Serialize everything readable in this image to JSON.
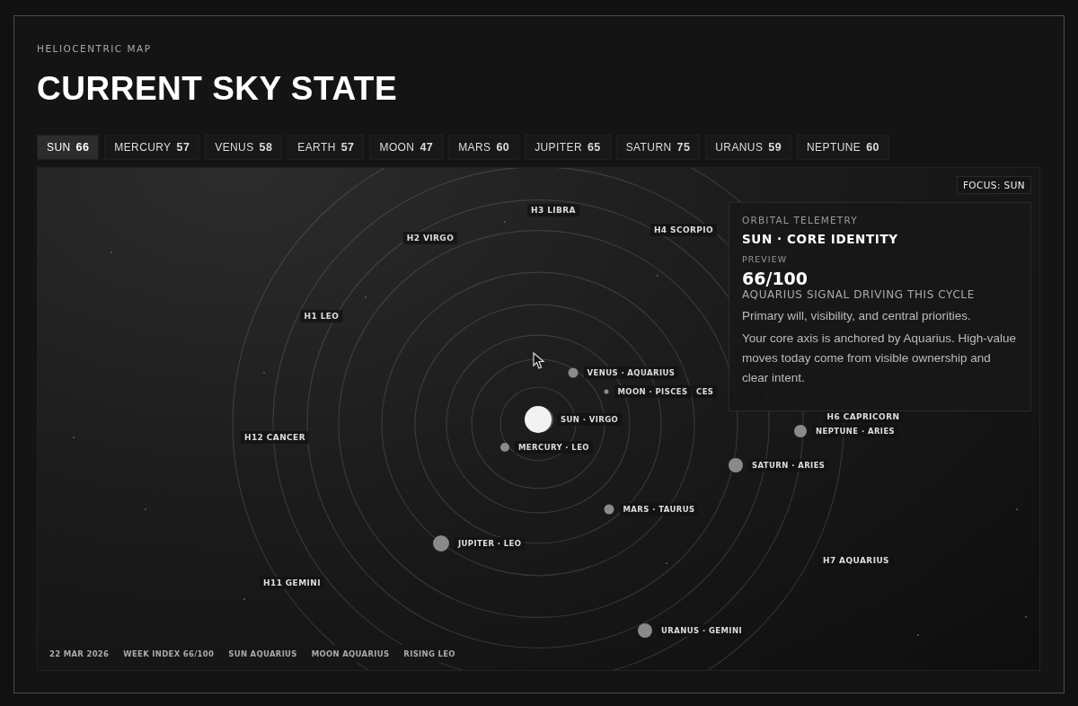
{
  "header": {
    "eyebrow": "HELIOCENTRIC MAP",
    "title": "CURRENT SKY STATE"
  },
  "tabs": [
    {
      "name": "SUN",
      "score": "66",
      "selected": true
    },
    {
      "name": "MERCURY",
      "score": "57",
      "selected": false
    },
    {
      "name": "VENUS",
      "score": "58",
      "selected": false
    },
    {
      "name": "EARTH",
      "score": "57",
      "selected": false
    },
    {
      "name": "MOON",
      "score": "47",
      "selected": false
    },
    {
      "name": "MARS",
      "score": "60",
      "selected": false
    },
    {
      "name": "JUPITER",
      "score": "65",
      "selected": false
    },
    {
      "name": "SATURN",
      "score": "75",
      "selected": false
    },
    {
      "name": "URANUS",
      "score": "59",
      "selected": false
    },
    {
      "name": "NEPTUNE",
      "score": "60",
      "selected": false
    }
  ],
  "map": {
    "focus_badge": "FOCUS: SUN",
    "houses": [
      "H3 LIBRA",
      "H2 VIRGO",
      "H4 SCORPIO",
      "H1 LEO",
      "H12 CANCER",
      "H11 GEMINI",
      "H6 CAPRICORN",
      "H7 AQUARIUS"
    ],
    "bodies": [
      {
        "label": "SUN · VIRGO",
        "kind": "star"
      },
      {
        "label": "MERCURY · LEO",
        "kind": "planet"
      },
      {
        "label": "VENUS · AQUARIUS",
        "kind": "planet"
      },
      {
        "label": "MOON · PISCES",
        "kind": "planet"
      },
      {
        "label": "CES",
        "kind": "covered"
      },
      {
        "label": "MARS · TAURUS",
        "kind": "planet"
      },
      {
        "label": "JUPITER · LEO",
        "kind": "planet"
      },
      {
        "label": "SATURN · ARIES",
        "kind": "planet"
      },
      {
        "label": "NEPTUNE · ARIES",
        "kind": "planet"
      },
      {
        "label": "URANUS · GEMINI",
        "kind": "planet"
      }
    ],
    "telemetry": {
      "eyebrow": "ORBITAL TELEMETRY",
      "heading": "SUN · CORE IDENTITY",
      "preview_label": "PREVIEW",
      "score": "66/100",
      "signal": "AQUARIUS SIGNAL DRIVING THIS CYCLE",
      "summary": "Primary will, visibility, and central priorities.",
      "body": "Your core axis is anchored by Aquarius. High-value moves today come from visible ownership and clear intent."
    },
    "footer_chips": [
      "22 MAR 2026",
      "WEEK INDEX 66/100",
      "SUN AQUARIUS",
      "MOON AQUARIUS",
      "RISING LEO"
    ]
  }
}
